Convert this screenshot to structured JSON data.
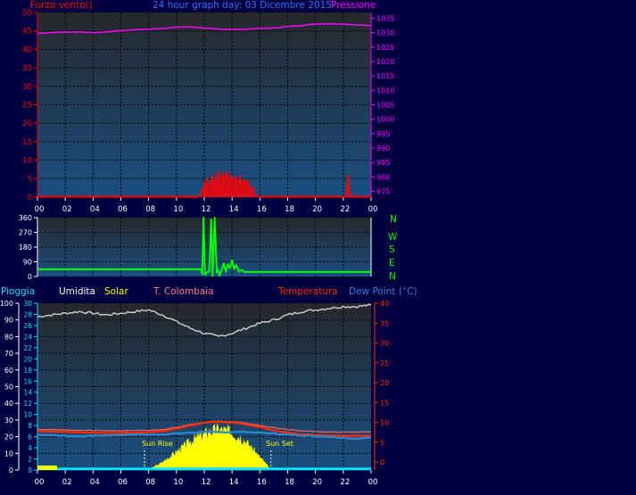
{
  "colors": {
    "background": "#000040",
    "plot_top": "#26282b",
    "plot_bottom": "#1a4f82",
    "grid": "#000000",
    "wind": "#ff0000",
    "pressure": "#ff00ff",
    "direction": "#00ff00",
    "rain": "#00e5ff",
    "humidity": "#c8c8c8",
    "solar": "#ffff00",
    "temperature": "#ff2a00",
    "dew_point": "#2a8ad4",
    "label_blue": "#3a6cff",
    "axis_text": "#ffffff"
  },
  "chart_data": [
    {
      "type": "line",
      "title": "24 hour graph day: 03 Dicembre 2015",
      "x_tick_labels": [
        "00",
        "02",
        "04",
        "06",
        "08",
        "10",
        "12",
        "14",
        "16",
        "18",
        "20",
        "22",
        "00"
      ],
      "x_range_hours": [
        0,
        24
      ],
      "left_axis": {
        "label": "Forza vento()",
        "range": [
          0,
          50
        ],
        "ticks": [
          0,
          5,
          10,
          15,
          20,
          25,
          30,
          35,
          40,
          45,
          50
        ]
      },
      "right_axis": {
        "label": "Pressione",
        "range": [
          973,
          1037
        ],
        "ticks": [
          975,
          980,
          985,
          990,
          995,
          1000,
          1005,
          1010,
          1015,
          1020,
          1025,
          1030,
          1035
        ]
      },
      "series": [
        {
          "name": "Pressione",
          "axis": "right",
          "x": [
            0,
            1,
            2,
            3,
            4,
            5,
            6,
            7,
            8,
            9,
            10,
            11,
            12,
            13,
            14,
            15,
            16,
            17,
            18,
            19,
            20,
            21,
            22,
            23,
            24
          ],
          "y": [
            1029.8,
            1030,
            1030.2,
            1030.3,
            1030,
            1030.3,
            1030.7,
            1031,
            1031.2,
            1031.5,
            1031.9,
            1032,
            1031.6,
            1031.2,
            1031.1,
            1031.2,
            1031.5,
            1031.6,
            1032.1,
            1032.5,
            1033,
            1033.1,
            1033,
            1032.7,
            1032.4
          ]
        },
        {
          "name": "Forza vento()",
          "axis": "left",
          "x": [
            0,
            11.5,
            11.9,
            12.0,
            12.15,
            12.3,
            12.45,
            12.6,
            12.75,
            12.9,
            13.05,
            13.2,
            13.35,
            13.5,
            13.65,
            13.8,
            13.95,
            14.1,
            14.25,
            14.4,
            14.55,
            14.7,
            14.85,
            15.0,
            15.15,
            15.3,
            15.45,
            15.6,
            16.0,
            22.2,
            22.35,
            22.5,
            24
          ],
          "y": [
            0,
            0,
            2,
            3.5,
            5,
            2,
            4.5,
            6,
            3,
            5.5,
            7,
            4,
            6.5,
            5,
            7,
            3.5,
            6,
            4,
            5.5,
            3,
            6,
            2.5,
            5,
            3.5,
            4.5,
            1.5,
            3,
            1,
            0,
            0,
            6,
            0,
            0
          ]
        }
      ]
    },
    {
      "type": "line",
      "right_axis_labels": [
        "N",
        "W",
        "S",
        "E",
        "N"
      ],
      "left_axis": {
        "range": [
          0,
          360
        ],
        "ticks": [
          0,
          90,
          180,
          270,
          360
        ]
      },
      "x_range_hours": [
        0,
        24
      ],
      "series": [
        {
          "name": "Direzione vento",
          "x": [
            0,
            11.75,
            11.85,
            11.95,
            12.05,
            12.2,
            12.35,
            12.5,
            12.6,
            12.75,
            12.9,
            13.0,
            13.1,
            13.25,
            13.4,
            13.55,
            13.7,
            13.85,
            14.0,
            14.15,
            14.3,
            14.5,
            14.7,
            14.9,
            15.1,
            24
          ],
          "y": [
            44,
            44,
            15,
            360,
            10,
            25,
            30,
            350,
            5,
            360,
            25,
            40,
            5,
            40,
            80,
            30,
            75,
            50,
            100,
            45,
            70,
            30,
            40,
            28,
            28,
            28
          ]
        }
      ]
    },
    {
      "type": "area",
      "x_tick_labels": [
        "00",
        "02",
        "04",
        "06",
        "08",
        "10",
        "12",
        "14",
        "16",
        "18",
        "20",
        "22",
        "00"
      ],
      "x_range_hours": [
        0,
        24
      ],
      "legend": [
        "Pioggia",
        "Umidita",
        "Solar",
        "T. Colombaia",
        "Temperatura",
        "Dew Point (°C)"
      ],
      "axes": {
        "humidity": {
          "range": [
            0,
            100
          ],
          "ticks": [
            0,
            10,
            20,
            30,
            40,
            50,
            60,
            70,
            80,
            90,
            100
          ]
        },
        "rain": {
          "range": [
            0,
            30
          ],
          "ticks": [
            0,
            2,
            4,
            6,
            8,
            10,
            12,
            14,
            16,
            18,
            20,
            22,
            24,
            26,
            28,
            30
          ]
        },
        "temperature": {
          "range": [
            -2,
            40
          ],
          "ticks": [
            0,
            5,
            10,
            15,
            20,
            25,
            30,
            35,
            40
          ]
        }
      },
      "annotations": [
        {
          "text": "Sun Rise",
          "x": 7.7
        },
        {
          "text": "Sun Set",
          "x": 16.8
        }
      ],
      "series": [
        {
          "name": "Umidita",
          "axis": "humidity",
          "x": [
            0,
            1,
            2,
            3,
            4,
            5,
            6,
            7,
            8,
            9,
            10,
            11,
            12,
            13,
            14,
            15,
            16,
            17,
            18,
            19,
            20,
            21,
            22,
            23,
            24
          ],
          "y": [
            92,
            93,
            94,
            95,
            94,
            93,
            94,
            95,
            96,
            93,
            89,
            85,
            82,
            80,
            82,
            85,
            88,
            90,
            93,
            95,
            96,
            97,
            98,
            98,
            99
          ]
        },
        {
          "name": "T. Colombaia",
          "axis": "temperature",
          "x": [
            0,
            1,
            2,
            3,
            4,
            5,
            6,
            7,
            8,
            9,
            10,
            11,
            12,
            13,
            14,
            15,
            16,
            17,
            18,
            19,
            20,
            21,
            22,
            23,
            24
          ],
          "y": [
            8.2,
            8.2,
            8.1,
            8.0,
            8.0,
            7.9,
            7.9,
            8.0,
            8.0,
            8.2,
            8.7,
            9.5,
            10.0,
            10.3,
            10.2,
            9.8,
            9.2,
            8.7,
            8.2,
            7.9,
            7.7,
            7.6,
            7.6,
            7.6,
            7.6
          ]
        },
        {
          "name": "Temperatura",
          "axis": "temperature",
          "x": [
            0,
            1,
            2,
            3,
            4,
            5,
            6,
            7,
            8,
            9,
            10,
            11,
            12,
            13,
            14,
            15,
            16,
            17,
            18,
            19,
            20,
            21,
            22,
            23,
            24
          ],
          "y": [
            7.8,
            7.7,
            7.6,
            7.5,
            7.4,
            7.3,
            7.3,
            7.4,
            7.5,
            7.8,
            8.4,
            9.2,
            9.9,
            10.1,
            10.0,
            9.5,
            8.8,
            8.0,
            7.4,
            7.0,
            6.8,
            6.7,
            6.6,
            6.6,
            6.6
          ]
        },
        {
          "name": "Dew Point (°C)",
          "axis": "temperature",
          "x": [
            0,
            1,
            2,
            3,
            4,
            5,
            6,
            7,
            8,
            9,
            10,
            11,
            12,
            13,
            14,
            15,
            16,
            17,
            18,
            19,
            20,
            21,
            22,
            23,
            24
          ],
          "y": [
            6.9,
            6.8,
            6.6,
            6.5,
            6.6,
            6.7,
            6.8,
            7.0,
            6.9,
            7.0,
            7.2,
            7.4,
            7.6,
            7.5,
            7.6,
            7.6,
            7.4,
            7.2,
            6.9,
            6.7,
            6.5,
            6.4,
            6.1,
            5.9,
            6.2
          ]
        },
        {
          "name": "Solar",
          "axis": "rain",
          "x": [
            0,
            7.7,
            8.3,
            9,
            9.5,
            10,
            10.5,
            11,
            11.5,
            12,
            12.5,
            13,
            13.5,
            14,
            14.5,
            15,
            15.5,
            16,
            16.5,
            16.8,
            24
          ],
          "y": [
            0,
            0,
            0.5,
            1.5,
            2.5,
            3.5,
            4.5,
            5.5,
            6.2,
            7.0,
            7.5,
            7.8,
            7.6,
            7.2,
            6.5,
            5.5,
            4.0,
            2.5,
            1.0,
            0,
            0
          ]
        },
        {
          "name": "Pioggia",
          "axis": "rain",
          "x": [
            0,
            24
          ],
          "y": [
            0,
            0
          ]
        }
      ]
    }
  ]
}
